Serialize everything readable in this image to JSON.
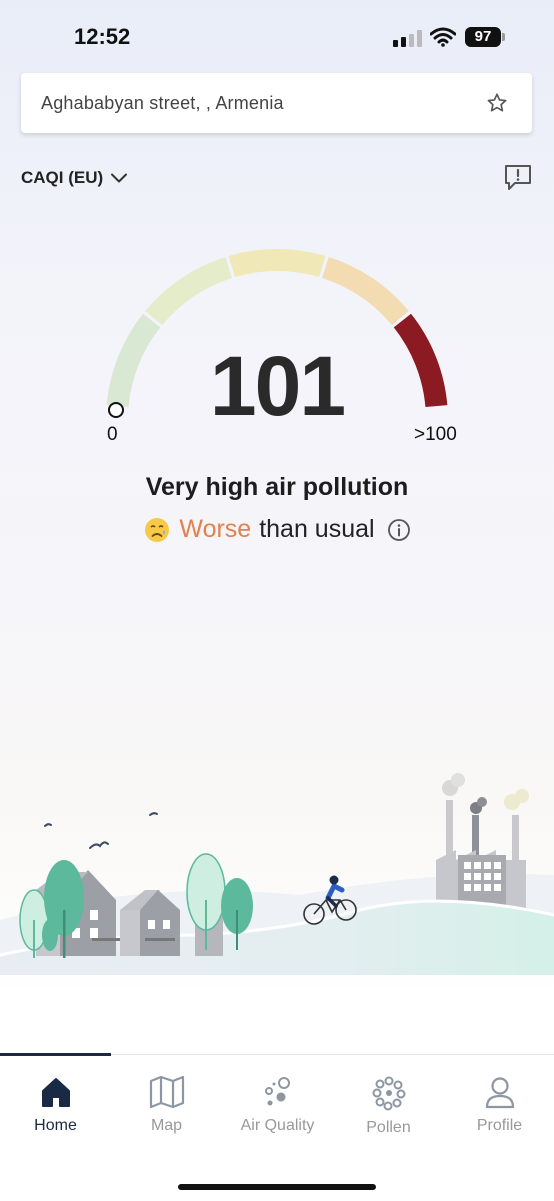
{
  "status_bar": {
    "time": "12:52",
    "battery": "97"
  },
  "search": {
    "location": "Aghababyan street,  , Armenia",
    "favorite_icon": "star-icon"
  },
  "index_selector": {
    "label": "CAQI (EU)",
    "dropdown_icon": "chevron-down-icon"
  },
  "feedback": {
    "icon": "feedback-icon"
  },
  "gauge": {
    "value": "101",
    "min_label": "0",
    "max_label": ">100",
    "level": 1.0,
    "segment_colors": [
      "#d9e8d3",
      "#e4ecca",
      "#f1e8b8",
      "#f3dcb2",
      "#8b1a22"
    ]
  },
  "status": {
    "level_text": "Very high air pollution",
    "trend_highlight": "Worse",
    "trend_rest": "than usual",
    "trend_color": "#e0824e"
  },
  "tabs": [
    {
      "label": "Home",
      "icon": "home-icon",
      "active": true
    },
    {
      "label": "Map",
      "icon": "map-icon",
      "active": false
    },
    {
      "label": "Air Quality",
      "icon": "air-quality-icon",
      "active": false
    },
    {
      "label": "Pollen",
      "icon": "pollen-icon",
      "active": false
    },
    {
      "label": "Profile",
      "icon": "profile-icon",
      "active": false
    }
  ]
}
